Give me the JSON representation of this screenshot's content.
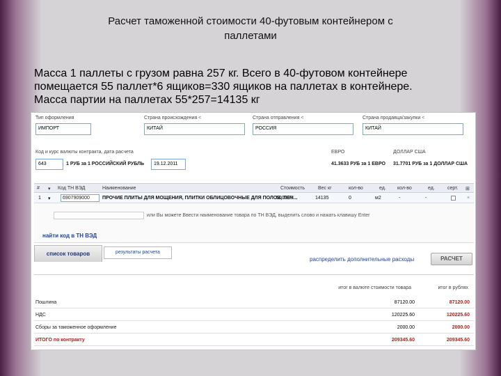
{
  "slide": {
    "title_line1": "Расчет таможенной стоимости 40-футовым контейнером с",
    "title_line2": "паллетами",
    "text_line1": "Масса 1 паллеты с грузом равна 257 кг. Всего в 40-футовом контейнере",
    "text_line2": "помещается 55 паллет*6 ящиков=330 ящиков на паллетах в контейнере.",
    "text_line3": "Масса партии на паллетах 55*257=14135 кг"
  },
  "form": {
    "type_label": "Тип оформления",
    "type_value": "ИМПОРТ",
    "origin_label": "Страна происхождения",
    "origin_value": "КИТАЙ",
    "dest_label": "Страна отправления",
    "dest_value": "РОССИЯ",
    "seller_label": "Страна продавца/закупки",
    "seller_value": "КИТАЙ",
    "chevron": "<",
    "rate_label": "Код и курс валюты контракта, дата расчета",
    "currency_code": "643",
    "rate_text": "1 РУБ за 1 РОССИЙСКИЙ РУБЛЬ",
    "date_value": "19.12.2011",
    "eur_label": "ЕВРО",
    "eur_rate": "41.3633 РУБ за 1 ЕВРО",
    "usd_label": "ДОЛЛАР США",
    "usd_rate": "31.7701 РУБ за 1 ДОЛЛАР США"
  },
  "grid": {
    "headers": [
      "#",
      "Код ТН ВЭД",
      "Наименование",
      "Стоимость",
      "Вес кг",
      "кол-во",
      "ед.",
      "кол-во",
      "ед.",
      "серт."
    ],
    "row": {
      "num": "1",
      "code": "6907909000",
      "name": "ПРОЧИЕ ПЛИТЫ ДЛЯ МОЩЕНИЯ, ПЛИТКИ ОБЛИЦОВОЧНЫЕ ДЛЯ ПОЛОВ, ПЕЧ...",
      "cost": "500000",
      "weight": "14135",
      "qty": "0",
      "unit": "м2",
      "qty2": "-",
      "unit2": "-"
    },
    "hint": "или Вы можете Ввести наименование товара по ТН ВЭД, выделить слово и нажать клавишу Enter",
    "find_code": "найти код в ТН ВЭД"
  },
  "tabs": {
    "main": "список товаров",
    "result": "результаты расчета"
  },
  "actions": {
    "distribute": "распределить дополнительные расходы",
    "calculate": "РАСЧЕТ"
  },
  "summary": {
    "col1_header": "итог в валюте стоимости товара",
    "col2_header": "итог в рублях",
    "rows": [
      {
        "name": "Пошлина",
        "v1": "87120.00",
        "v2": "87120.00"
      },
      {
        "name": "НДС",
        "v1": "120225.60",
        "v2": "120225.60"
      },
      {
        "name": "Сборы за таможенное оформление",
        "v1": "2000.00",
        "v2": "2000.00"
      },
      {
        "name": "ИТОГО по контракту",
        "v1": "209345.60",
        "v2": "209345.60"
      }
    ]
  }
}
